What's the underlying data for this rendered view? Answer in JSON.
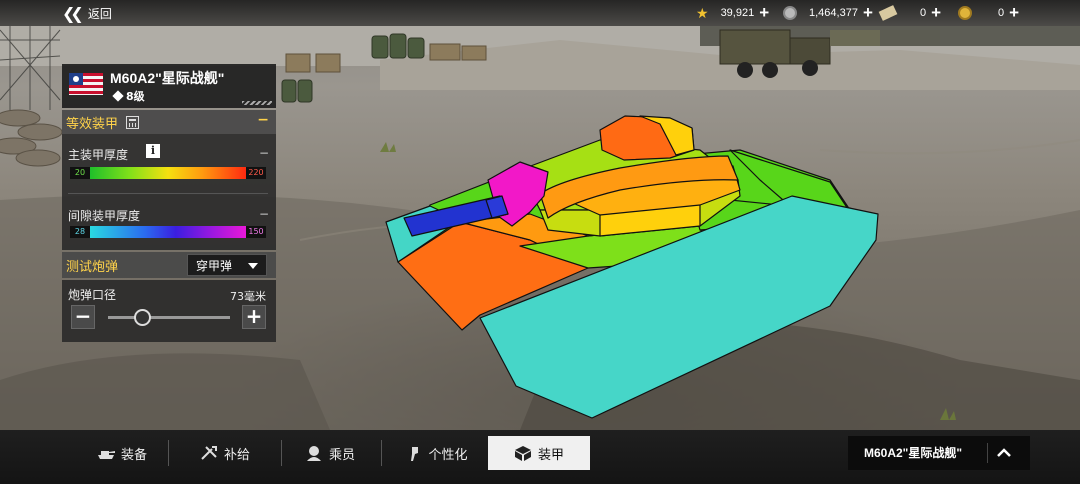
{
  "topbar": {
    "back_label": "返回",
    "resources": [
      {
        "icon": "gold-star-icon",
        "value": "39,921",
        "color": "#f2c230"
      },
      {
        "icon": "silver-credits-icon",
        "value": "1,464,377",
        "color": "#b9b9b9"
      },
      {
        "icon": "experience-ticket-icon",
        "value": "0",
        "color": "#d8c9a0"
      },
      {
        "icon": "gold-coin-icon",
        "value": "0",
        "color": "#e0b43a"
      }
    ]
  },
  "tank": {
    "name": "M60A2\"星际战舰\"",
    "tier": "8级",
    "flag": "usa-flag-icon"
  },
  "armor_panel": {
    "title": "等效装甲",
    "collapse": "−",
    "main_armor": {
      "label": "主装甲厚度",
      "min": "20",
      "max": "220",
      "collapse": "−"
    },
    "spaced_armor": {
      "label": "间隙装甲厚度",
      "min": "28",
      "max": "150",
      "collapse": "−"
    }
  },
  "shell_panel": {
    "title": "测试炮弹",
    "selected_shell": "穿甲弹",
    "caliber_label": "炮弹口径",
    "caliber_value": "73毫米",
    "caliber_slider_level": 0.28,
    "minus": "−",
    "plus": "+"
  },
  "bottom_tabs": [
    {
      "label": "装备",
      "icon": "tank-icon"
    },
    {
      "label": "补给",
      "icon": "tools-icon"
    },
    {
      "label": "乘员",
      "icon": "crew-icon"
    },
    {
      "label": "个性化",
      "icon": "paint-brush-icon"
    },
    {
      "label": "装甲",
      "icon": "armor-box-icon",
      "active": true
    }
  ],
  "vehicle_selector": {
    "name": "M60A2\"星际战舰\""
  },
  "colors": {
    "accent": "#ffd34a",
    "active_tab_bg": "#f0f0f0"
  }
}
